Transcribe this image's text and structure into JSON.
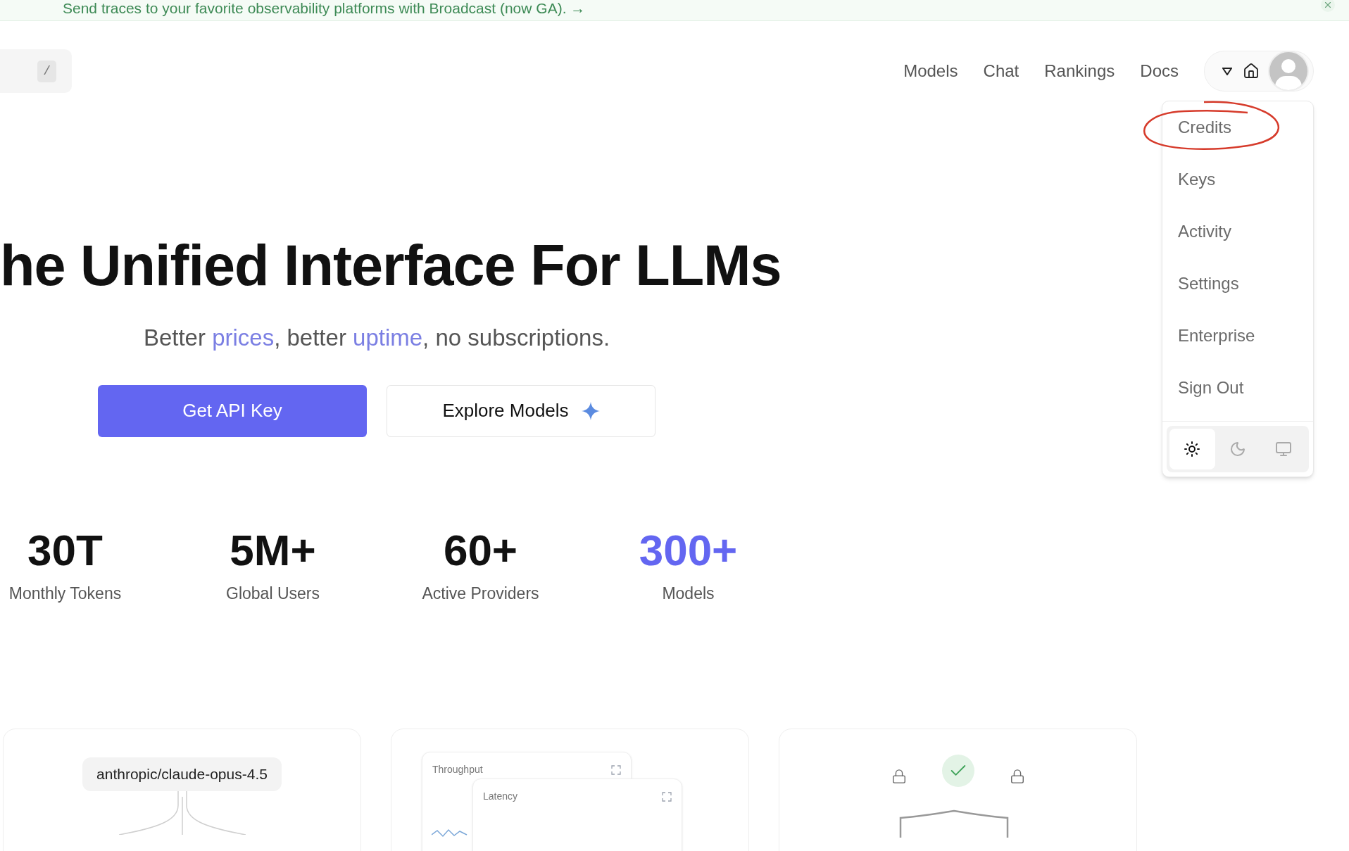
{
  "banner": {
    "text": "Send traces to your favorite observability platforms with Broadcast (now GA). →"
  },
  "search": {
    "shortcut": "/"
  },
  "nav": {
    "links": [
      "Models",
      "Chat",
      "Rankings",
      "Docs"
    ]
  },
  "account_menu": {
    "expanded": true,
    "items": [
      {
        "label": "Credits"
      },
      {
        "label": "Keys"
      },
      {
        "label": "Activity"
      },
      {
        "label": "Settings"
      },
      {
        "label": "Enterprise"
      },
      {
        "label": "Sign Out"
      }
    ],
    "themes": [
      {
        "kind": "light",
        "selected": true
      },
      {
        "kind": "dark",
        "selected": false
      },
      {
        "kind": "system",
        "selected": false
      }
    ]
  },
  "hero": {
    "title": "he Unified Interface For LLMs",
    "subtitle": [
      {
        "text": "Better ",
        "link": false
      },
      {
        "text": "prices",
        "link": true
      },
      {
        "text": ", better ",
        "link": false
      },
      {
        "text": "uptime",
        "link": true
      },
      {
        "text": ", no subscriptions.",
        "link": false
      }
    ],
    "buttons": [
      {
        "label": "Get API Key",
        "kind": "primary"
      },
      {
        "label": "Explore Models",
        "kind": "secondary"
      }
    ]
  },
  "stats": [
    {
      "value": "30T",
      "label": "Monthly Tokens",
      "highlighted": false
    },
    {
      "value": "5M+",
      "label": "Global Users",
      "highlighted": false
    },
    {
      "value": "60+",
      "label": "Active Providers",
      "highlighted": false
    },
    {
      "value": "300+",
      "label": "Models",
      "highlighted": true
    }
  ],
  "cards": [
    {
      "kind": "model",
      "model": "anthropic/claude-opus-4.5"
    },
    {
      "kind": "charts",
      "panels": [
        "Throughput",
        "Latency"
      ]
    },
    {
      "kind": "security"
    }
  ]
}
